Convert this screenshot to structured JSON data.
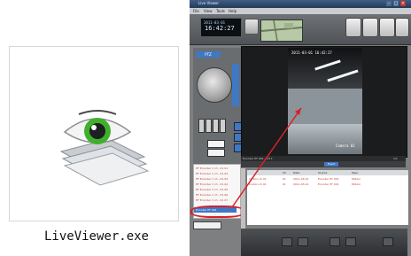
{
  "file_icon": {
    "caption": "LiveViewer.exe",
    "icon": "eye-icon"
  },
  "app": {
    "title": "Live Viewer",
    "menu": [
      "File",
      "View",
      "Tools",
      "Help"
    ],
    "clock": {
      "line1": "2011-03-01",
      "line2": "16:42:27"
    },
    "ptz_label": "PTZ",
    "video": {
      "timestamp": "2011-03-01 16:42:27",
      "camera_label": "Camera 01",
      "bar_left": "Encoder PT 001 - CH 1",
      "bar_right": "1/1"
    },
    "tab_label": "Event",
    "camera_list": [
      "HF Encoder 1 ch - 01 01",
      "HF Encoder 1 ch - 01 02",
      "HF Encoder 1 ch - 01 03",
      "HF Encoder 1 ch - 01 04",
      "HF Encoder 1 ch - 01 05",
      "HF Encoder 1 ch - 01 06",
      "HF Encoder 1 ch - 01 07"
    ],
    "camera_list_selected": "Encoder PT 001",
    "events": {
      "columns": [
        "",
        "Ch",
        "Date",
        "Source",
        "Type"
      ],
      "rows": [
        [
          "motion ch 01",
          "01",
          "2011-03-01",
          "Encoder PT 001",
          "Motion"
        ],
        [
          "motion ch 01",
          "01",
          "2011-03-01",
          "Encoder PT 001",
          "Motion"
        ]
      ]
    },
    "colors": {
      "accent": "#3f78c5",
      "highlight": "#d8202a",
      "background": "#7d7f81"
    }
  }
}
